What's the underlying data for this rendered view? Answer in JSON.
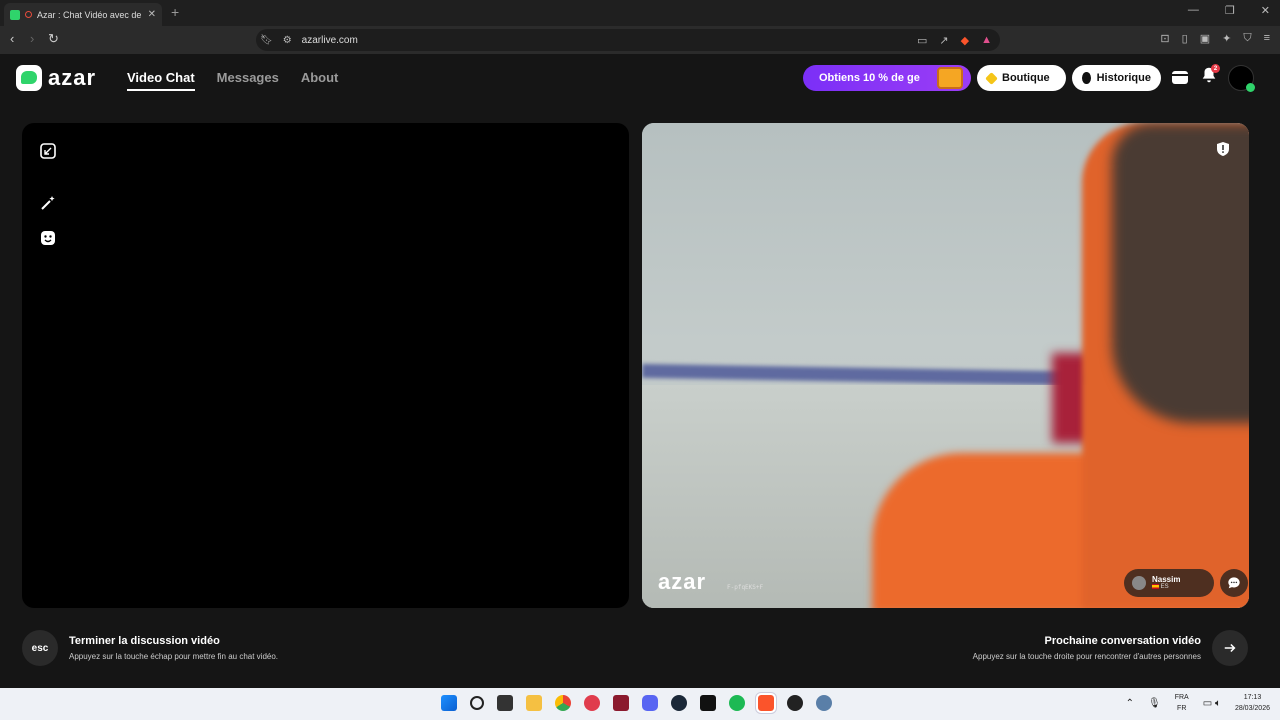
{
  "browser": {
    "tab_title": "Azar : Chat Vidéo avec de no",
    "url": "azarlive.com",
    "close_tab_glyph": "✕",
    "new_tab_glyph": "+"
  },
  "header": {
    "logo_text": "azar",
    "nav": [
      {
        "label": "Video Chat",
        "active": true
      },
      {
        "label": "Messages",
        "active": false
      },
      {
        "label": "About",
        "active": false
      }
    ],
    "promo_label": "Obtiens 10 % de ge",
    "shop_label": "Boutique",
    "history_label": "Historique",
    "notification_count": "2"
  },
  "left_panel": {
    "tools": [
      "minimize-icon",
      "magic-wand-icon",
      "sticker-icon"
    ]
  },
  "right_panel": {
    "watermark": "azar",
    "watermark_code": "F-pfqEKS+F",
    "user_name": "Nassim",
    "user_country": "ES"
  },
  "controls": {
    "esc_key": "esc",
    "end_title": "Terminer la discussion vidéo",
    "end_subtitle": "Appuyez sur la touche échap pour mettre fin au chat vidéo.",
    "next_title": "Prochaine conversation vidéo",
    "next_subtitle": "Appuyez sur la touche droite pour rencontrer d'autres personnes"
  },
  "taskbar": {
    "lang_top": "FRA",
    "lang_bottom": "FR",
    "time": "17:13",
    "date": "28/03/2026"
  },
  "colors": {
    "brand_green": "#2fd46b",
    "promo_purple": "#8a36f6",
    "notification_red": "#e63946"
  }
}
